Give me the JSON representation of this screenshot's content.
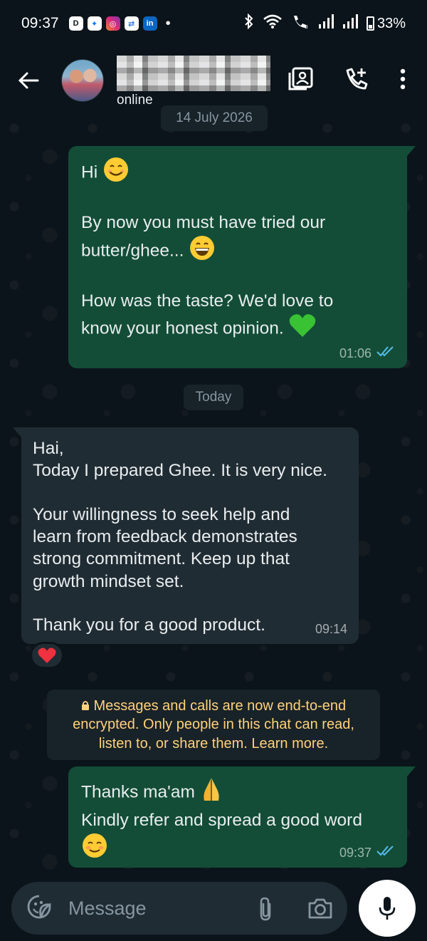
{
  "status_bar": {
    "time": "09:37",
    "battery_percent": "33%",
    "notification_icons": [
      "payment-app-icon",
      "messenger-icon",
      "instagram-icon",
      "bluetooth-transfer-icon",
      "linkedin-icon"
    ]
  },
  "header": {
    "status": "online",
    "actions": [
      "contact-card-icon",
      "add-call-icon",
      "more-options-icon"
    ]
  },
  "chat": {
    "date_chip_1": "14 July 2026",
    "date_chip_2": "Today",
    "messages": [
      {
        "direction": "outgoing",
        "line1": "Hi",
        "line2": "By now you must have tried our",
        "line3": "butter/ghee...",
        "line4": "How was the taste? We'd love to",
        "line5": "know your honest opinion.",
        "time": "01:06",
        "status": "read"
      },
      {
        "direction": "incoming",
        "line1": "Hai,",
        "line2": "Today I prepared Ghee. It is very nice.",
        "line3": "Your willingness to seek help and",
        "line4": "learn from feedback demonstrates",
        "line5": "strong commitment. Keep up that",
        "line6": "growth mindset set.",
        "line7": "Thank you for a good product.",
        "time": "09:14",
        "reaction": "heart"
      },
      {
        "direction": "outgoing",
        "line1": "Thanks ma'am",
        "line2": "Kindly refer and spread a good word",
        "time": "09:37",
        "status": "read"
      }
    ],
    "encryption_notice": {
      "line1": "Messages and calls are now end-to-end",
      "line2": "encrypted. Only people in this chat can read,",
      "line3": "listen to, or share them. Learn more."
    }
  },
  "composer": {
    "placeholder": "Message"
  },
  "colors": {
    "background": "#0b141a",
    "outgoing_bubble": "#134d37",
    "incoming_bubble": "#202c33",
    "read_ticks": "#53bdeb",
    "notice_text": "#ffd279"
  }
}
